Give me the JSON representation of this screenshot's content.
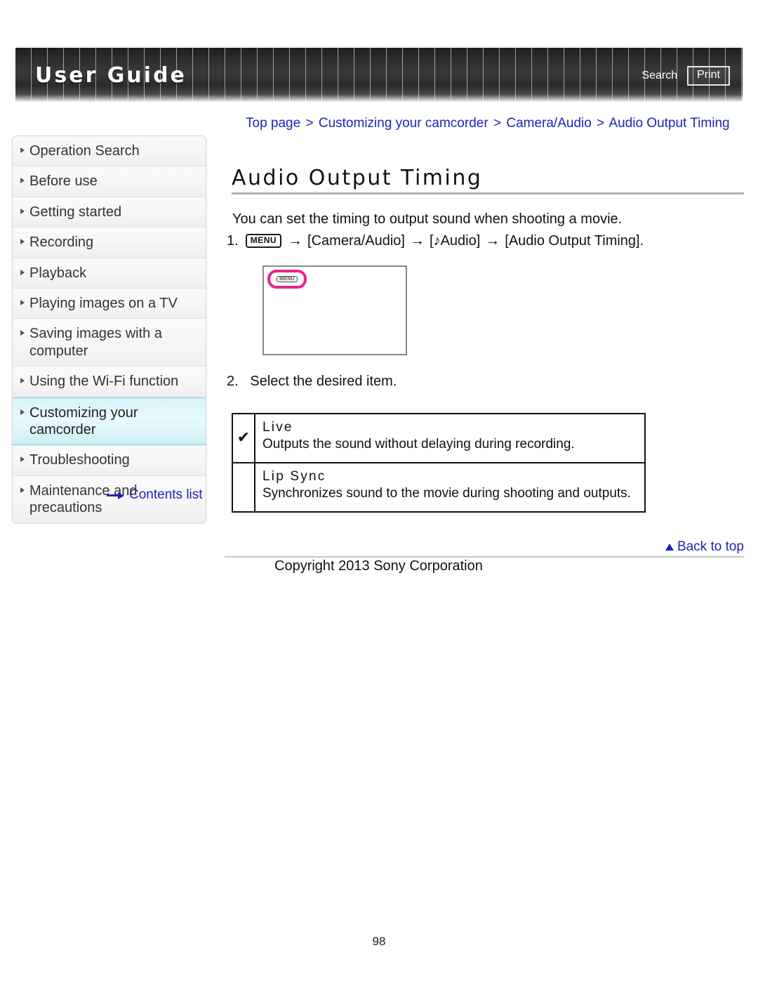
{
  "header": {
    "title": "User Guide",
    "search_label": "Search",
    "print_label": "Print"
  },
  "sidebar": {
    "items": [
      {
        "label": "Operation Search",
        "selected": false
      },
      {
        "label": "Before use",
        "selected": false
      },
      {
        "label": "Getting started",
        "selected": false
      },
      {
        "label": "Recording",
        "selected": false
      },
      {
        "label": "Playback",
        "selected": false
      },
      {
        "label": "Playing images on a TV",
        "selected": false
      },
      {
        "label": "Saving images with a computer",
        "selected": false
      },
      {
        "label": "Using the Wi-Fi function",
        "selected": false
      },
      {
        "label": "Customizing your camcorder",
        "selected": true
      },
      {
        "label": "Troubleshooting",
        "selected": false
      },
      {
        "label": "Maintenance and precautions",
        "selected": false
      }
    ],
    "contents_link": "Contents list"
  },
  "breadcrumb": {
    "items": [
      "Top page",
      "Customizing your camcorder",
      "Camera/Audio",
      "Audio Output Timing"
    ],
    "separator": ">"
  },
  "main": {
    "title": "Audio Output Timing",
    "intro": "You can set the timing to output sound when shooting a movie.",
    "step1": {
      "number": "1.",
      "menu_chip": "MENU",
      "arrow": "→",
      "part1": "[Camera/Audio]",
      "note_icon": "♪",
      "part2": "Audio]",
      "part2_open": "[",
      "part3": "[Audio Output Timing]."
    },
    "screenshot": {
      "menu_chip": "MENU",
      "highlight_color": "#e8258f"
    },
    "step2": {
      "number": "2.",
      "text": "Select the desired item."
    },
    "options": [
      {
        "checked": true,
        "check_glyph": "✔",
        "name": "Live",
        "description": "Outputs the sound without delaying during recording."
      },
      {
        "checked": false,
        "check_glyph": "",
        "name": "Lip Sync",
        "description": "Synchronizes sound to the movie during shooting and outputs."
      }
    ]
  },
  "footer": {
    "back_to_top": "Back to top",
    "copyright": "Copyright 2013 Sony Corporation",
    "page_number": "98"
  },
  "colors": {
    "link": "#2222bb",
    "highlight": "#e8258f",
    "selected_nav": "#d8f3f7"
  }
}
